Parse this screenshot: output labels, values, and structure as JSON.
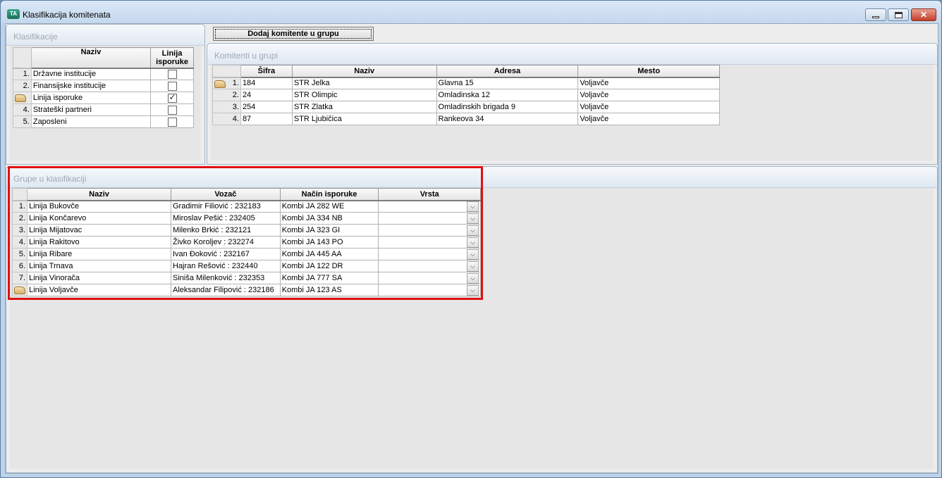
{
  "window": {
    "title": "Klasifikacija komitenata",
    "close_glyph": "✕"
  },
  "add_button": {
    "label": "Dodaj komitente u grupu"
  },
  "klasifikacije": {
    "title": "Klasifikacije",
    "headers": {
      "naziv": "Naziv",
      "linija_line1": "Linija",
      "linija_line2": "isporuke"
    },
    "rows": [
      {
        "num": "1.",
        "naziv": "Državne institucije",
        "checked": false
      },
      {
        "num": "2.",
        "naziv": "Finansijske institucije",
        "checked": false
      },
      {
        "num": "",
        "naziv": "Linija isporuke",
        "checked": true
      },
      {
        "num": "4.",
        "naziv": "Strateški partneri",
        "checked": false
      },
      {
        "num": "5.",
        "naziv": "Zaposleni",
        "checked": false
      }
    ]
  },
  "komitenti": {
    "title": "Komitenti u grupi",
    "headers": {
      "sifra": "Šifra",
      "naziv": "Naziv",
      "adresa": "Adresa",
      "mesto": "Mesto"
    },
    "rows": [
      {
        "num": "1.",
        "sifra": "184",
        "naziv": "STR Jelka",
        "adresa": "Glavna 15",
        "mesto": "Voljavče"
      },
      {
        "num": "2.",
        "sifra": "24",
        "naziv": "STR Olimpic",
        "adresa": "Omladinska 12",
        "mesto": "Voljavče"
      },
      {
        "num": "3.",
        "sifra": "254",
        "naziv": "STR Zlatka",
        "adresa": "Omladinskih brigada 9",
        "mesto": "Voljavče"
      },
      {
        "num": "4.",
        "sifra": "87",
        "naziv": "STR Ljubičica",
        "adresa": "Rankeova 34",
        "mesto": "Voljavče"
      }
    ]
  },
  "grupe": {
    "title": "Grupe u klasifikaciji",
    "headers": {
      "naziv": "Naziv",
      "vozac": "Vozač",
      "nacin": "Način isporuke",
      "vrsta": "Vrsta"
    },
    "dropdown_glyph": "⌵",
    "rows": [
      {
        "num": "1.",
        "naziv": "Linija Bukovče",
        "vozac": "Gradimir Filiović : 232183",
        "nacin": "Kombi JA 282 WE",
        "vrsta": ""
      },
      {
        "num": "2.",
        "naziv": "Linija Končarevo",
        "vozac": "Miroslav Pešić : 232405",
        "nacin": "Kombi JA 334 NB",
        "vrsta": ""
      },
      {
        "num": "3.",
        "naziv": "Linija Mijatovac",
        "vozac": "Milenko Brkić : 232121",
        "nacin": "Kombi JA 323 GI",
        "vrsta": ""
      },
      {
        "num": "4.",
        "naziv": "Linija Rakitovo",
        "vozac": "Živko Koroljev : 232274",
        "nacin": "Kombi JA 143 PO",
        "vrsta": ""
      },
      {
        "num": "5.",
        "naziv": "Linija Ribare",
        "vozac": "Ivan Đoković : 232167",
        "nacin": "Kombi JA 445 AA",
        "vrsta": ""
      },
      {
        "num": "6.",
        "naziv": "Linija Trnava",
        "vozac": "Hajran Rešović : 232440",
        "nacin": "Kombi JA 122 DR",
        "vrsta": ""
      },
      {
        "num": "7.",
        "naziv": "Linija Vinorača",
        "vozac": "Siniša Milenković : 232353",
        "nacin": "Kombi JA 777 SA",
        "vrsta": ""
      },
      {
        "num": "",
        "naziv": "Linija Voljavče",
        "vozac": "Aleksandar Filipović : 232186",
        "nacin": "Kombi JA 123 AS",
        "vrsta": ""
      }
    ]
  }
}
